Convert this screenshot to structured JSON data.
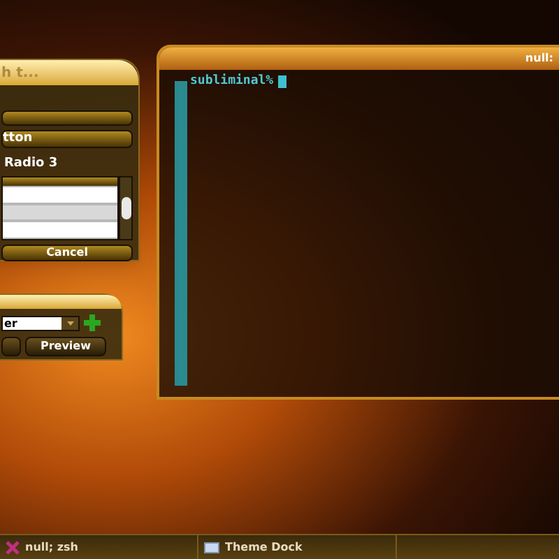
{
  "dialog": {
    "title": "h t...",
    "button_label": "tton",
    "radio_label": "Radio 3",
    "list_rows": [
      {
        "selected": false
      },
      {
        "selected": true
      },
      {
        "selected": false
      }
    ],
    "cancel": "Cancel"
  },
  "preview_dialog": {
    "combo_value": "er",
    "preview": "Preview"
  },
  "terminal": {
    "title": "null:",
    "prompt": "subliminal%"
  },
  "taskbar": [
    {
      "label": "null; zsh",
      "kind": "terminal"
    },
    {
      "label": "Theme Dock",
      "kind": "window"
    }
  ]
}
